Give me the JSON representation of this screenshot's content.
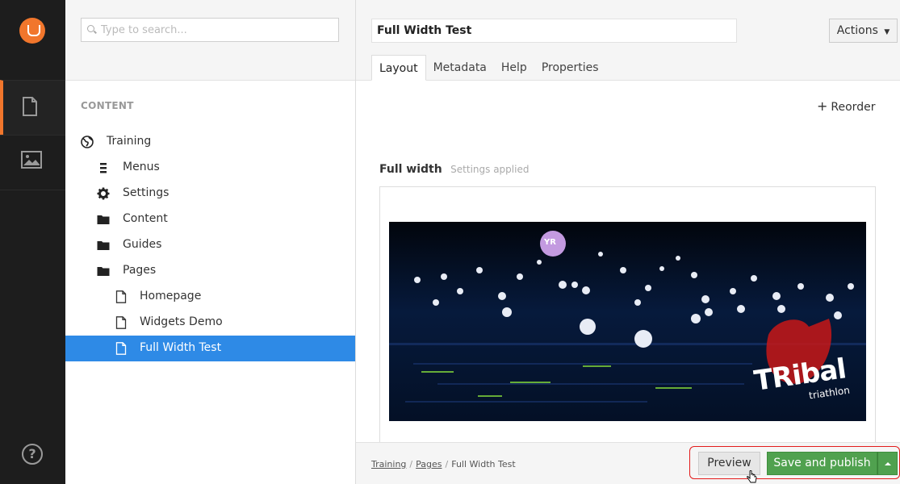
{
  "search": {
    "placeholder": "Type to search..."
  },
  "tree": {
    "section_label": "CONTENT",
    "nodes": [
      {
        "label": "Training",
        "icon": "globe-icon"
      },
      {
        "label": "Menus",
        "icon": "list-icon"
      },
      {
        "label": "Settings",
        "icon": "gear-icon"
      },
      {
        "label": "Content",
        "icon": "folder-icon"
      },
      {
        "label": "Guides",
        "icon": "folder-icon"
      },
      {
        "label": "Pages",
        "icon": "folder-icon"
      },
      {
        "label": "Homepage",
        "icon": "document-icon"
      },
      {
        "label": "Widgets Demo",
        "icon": "document-icon"
      },
      {
        "label": "Full Width Test",
        "icon": "document-icon",
        "selected": true
      }
    ]
  },
  "editor": {
    "title_value": "Full Width Test",
    "actions_label": "Actions",
    "tabs": [
      {
        "label": "Layout",
        "active": true
      },
      {
        "label": "Metadata"
      },
      {
        "label": "Help"
      },
      {
        "label": "Properties"
      }
    ],
    "reorder_label": "Reorder",
    "full_width_title": "Full width",
    "full_width_note": "Settings applied",
    "image_brand": "TRibal",
    "image_brand_sub": "triathlon",
    "image_buoy": "YR"
  },
  "footer": {
    "breadcrumbs": [
      "Training",
      "Pages",
      "Full Width Test"
    ],
    "preview_label": "Preview",
    "publish_label": "Save and publish"
  },
  "colors": {
    "accent": "#f1762c",
    "selected": "#2e8ae6",
    "publish": "#50a14f",
    "highlight": "#e31b1b"
  }
}
